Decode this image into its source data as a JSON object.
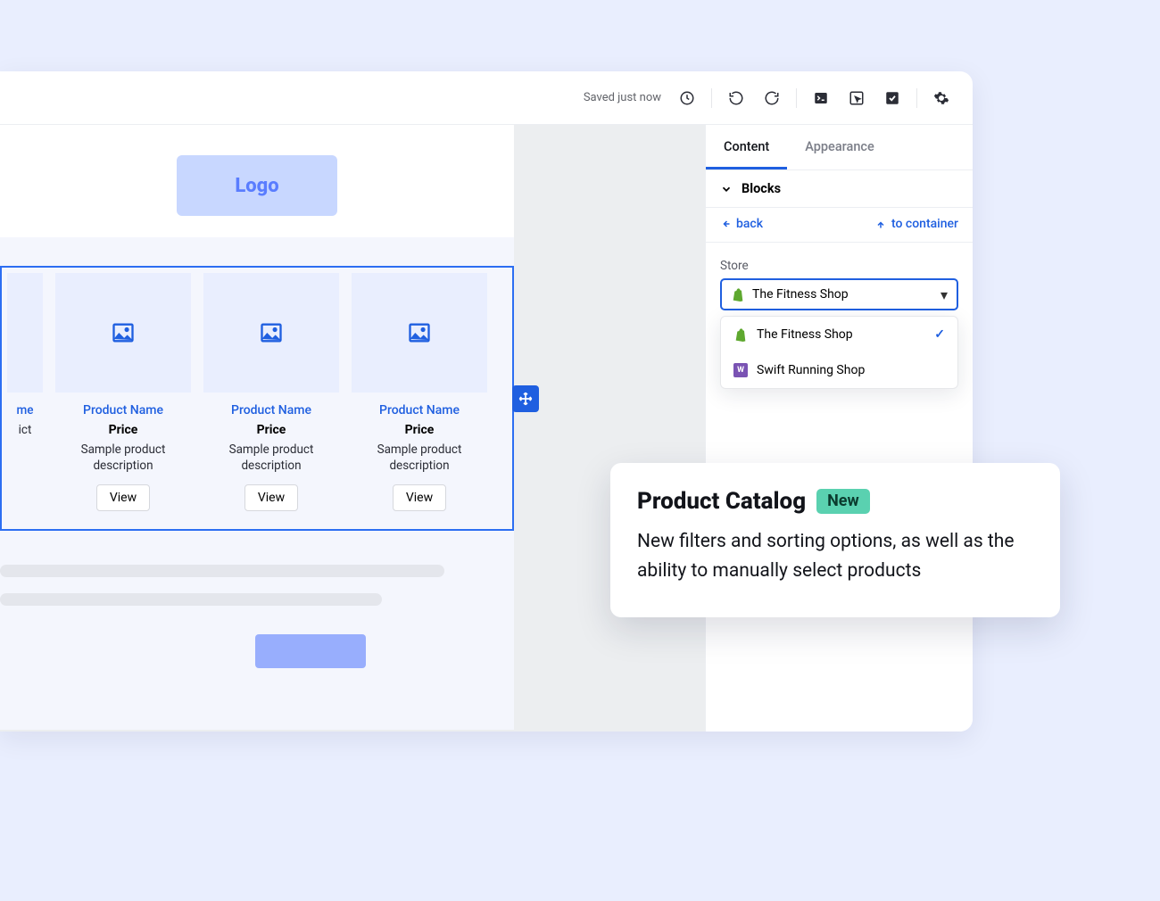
{
  "toolbar": {
    "saved_text": "Saved just now"
  },
  "canvas": {
    "logo_text": "Logo",
    "products": [
      {
        "name": "me",
        "price": "",
        "desc": "ict",
        "view": ""
      },
      {
        "name": "Product Name",
        "price": "Price",
        "desc": "Sample product description",
        "view": "View"
      },
      {
        "name": "Product Name",
        "price": "Price",
        "desc": "Sample product description",
        "view": "View"
      },
      {
        "name": "Product Name",
        "price": "Price",
        "desc": "Sample product description",
        "view": "View"
      }
    ]
  },
  "sidepanel": {
    "tabs": {
      "content": "Content",
      "appearance": "Appearance"
    },
    "blocks_label": "Blocks",
    "back_label": "back",
    "to_container_label": "to container",
    "store_label": "Store",
    "store_selected": "The Fitness Shop",
    "store_options": [
      {
        "icon": "shopify",
        "name": "The Fitness Shop",
        "selected": true
      },
      {
        "icon": "woo",
        "name": "Swift Running Shop",
        "selected": false
      }
    ]
  },
  "callout": {
    "title": "Product Catalog",
    "badge": "New",
    "body": "New filters and sorting options, as well as the ability to manually select products"
  }
}
